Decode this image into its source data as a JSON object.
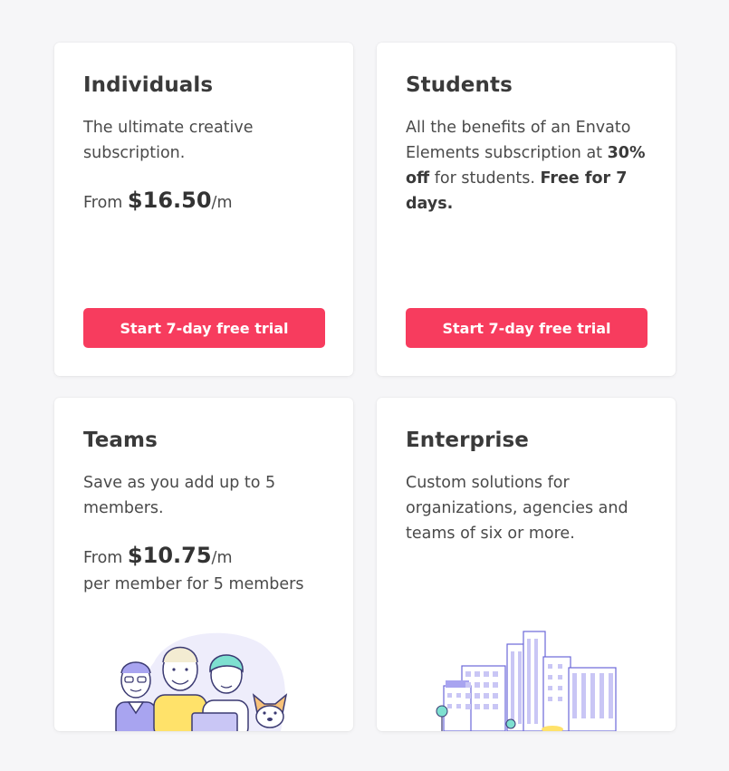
{
  "colors": {
    "background": "#f6f6f8",
    "accent": "#f73c5e",
    "card": "#ffffff",
    "illustration": "#a8a4f0"
  },
  "cards": {
    "individuals": {
      "title": "Individuals",
      "description": "The ultimate creative subscription.",
      "price_prefix": "From ",
      "price_amount": "$16.50",
      "price_suffix": "/m",
      "cta": "Start 7-day free trial"
    },
    "students": {
      "title": "Students",
      "desc_1": "All the benefits of an Envato Elements subscription at ",
      "desc_bold_1": "30% off",
      "desc_2": " for students. ",
      "desc_bold_2": "Free for 7 days.",
      "cta": "Start 7-day free trial"
    },
    "teams": {
      "title": "Teams",
      "description": "Save as you add up to 5 members.",
      "price_prefix": "From ",
      "price_amount": "$10.75",
      "price_suffix": "/m",
      "price_note": "per member for 5 members",
      "illustration": "people-team-illustration"
    },
    "enterprise": {
      "title": "Enterprise",
      "description": "Custom solutions for organizations, agencies and teams of six or more.",
      "illustration": "city-buildings-illustration"
    }
  }
}
